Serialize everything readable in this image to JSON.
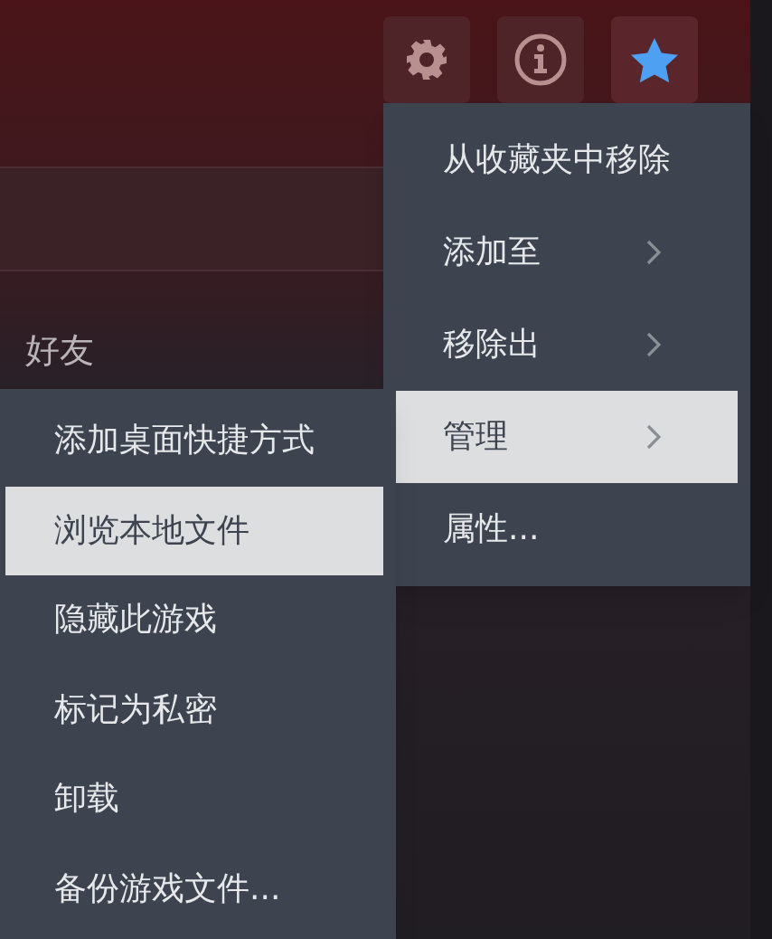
{
  "toolbar": [
    {
      "kind": "gear",
      "on": false
    },
    {
      "kind": "info",
      "on": false
    },
    {
      "kind": "star",
      "on": true
    }
  ],
  "background_label": "好友",
  "menu": {
    "items": [
      {
        "label": "从收藏夹中移除",
        "submenu": false,
        "selected": false
      },
      {
        "label": "添加至",
        "submenu": true,
        "selected": false
      },
      {
        "label": "移除出",
        "submenu": true,
        "selected": false
      },
      {
        "label": "管理",
        "submenu": true,
        "selected": true
      },
      {
        "label": "属性...",
        "submenu": false,
        "selected": false
      }
    ]
  },
  "submenu": {
    "items": [
      {
        "label": "添加桌面快捷方式",
        "selected": false
      },
      {
        "label": "浏览本地文件",
        "selected": true
      },
      {
        "label": "隐藏此游戏",
        "selected": false
      },
      {
        "label": "标记为私密",
        "selected": false
      },
      {
        "label": "卸载",
        "selected": false
      },
      {
        "label": "备份游戏文件...",
        "selected": false
      }
    ]
  }
}
